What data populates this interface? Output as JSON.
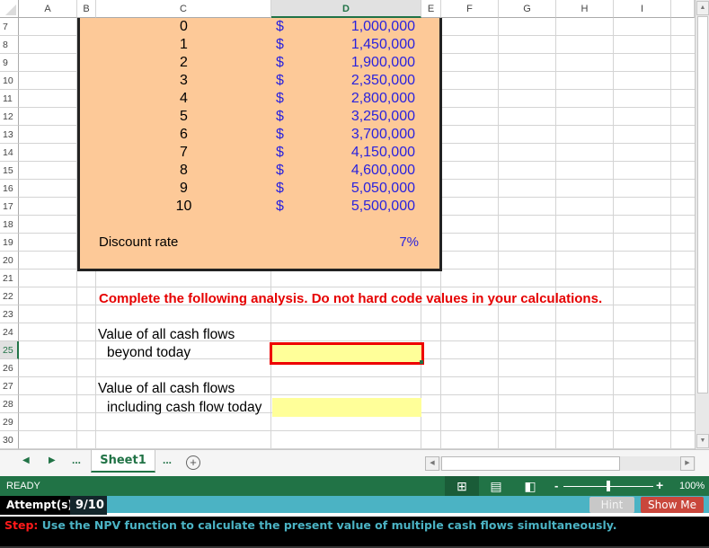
{
  "columns": [
    "A",
    "B",
    "C",
    "D",
    "E",
    "F",
    "G",
    "H",
    "I"
  ],
  "selected_column": "D",
  "rows": [
    7,
    8,
    9,
    10,
    11,
    12,
    13,
    14,
    15,
    16,
    17,
    18,
    19,
    20,
    21,
    22,
    23,
    24,
    25,
    26,
    27,
    28,
    29,
    30
  ],
  "selected_row": 25,
  "cash_flows": [
    {
      "period": "0",
      "currency": "$",
      "amount": "1,000,000"
    },
    {
      "period": "1",
      "currency": "$",
      "amount": "1,450,000"
    },
    {
      "period": "2",
      "currency": "$",
      "amount": "1,900,000"
    },
    {
      "period": "3",
      "currency": "$",
      "amount": "2,350,000"
    },
    {
      "period": "4",
      "currency": "$",
      "amount": "2,800,000"
    },
    {
      "period": "5",
      "currency": "$",
      "amount": "3,250,000"
    },
    {
      "period": "6",
      "currency": "$",
      "amount": "3,700,000"
    },
    {
      "period": "7",
      "currency": "$",
      "amount": "4,150,000"
    },
    {
      "period": "8",
      "currency": "$",
      "amount": "4,600,000"
    },
    {
      "period": "9",
      "currency": "$",
      "amount": "5,050,000"
    },
    {
      "period": "10",
      "currency": "$",
      "amount": "5,500,000"
    }
  ],
  "discount_rate": {
    "label": "Discount rate",
    "value": "7%"
  },
  "instruction": "Complete the following analysis. Do not hard code values in your calculations.",
  "analysis": {
    "q1_line1": "Value of all cash flows",
    "q1_line2": "beyond today",
    "q1_value": "",
    "q2_line1": "Value of all cash flows",
    "q2_line2": "including cash flow today",
    "q2_value": ""
  },
  "tabs": {
    "prev": "◀",
    "next": "▶",
    "more_left": "...",
    "sheet": "Sheet1",
    "more_right": "...",
    "add": "+"
  },
  "status": {
    "mode": "READY",
    "zoom_minus": "-",
    "zoom_plus": "+",
    "zoom": "100%",
    "zoom_level_percent": 100
  },
  "attempts": {
    "label": "Attempt(s)",
    "value": "9/10"
  },
  "buttons": {
    "hint": "Hint",
    "show_me": "Show Me"
  },
  "step": {
    "label": "Step:",
    "text": " Use the NPV function to calculate the present value of multiple cash flows simultaneously."
  },
  "colors": {
    "accent": "#217346",
    "input_fill": "#ffff99",
    "block_fill": "#fdc998",
    "value_blue": "#2a22dd",
    "instruction_red": "#e60000",
    "active_border": "#ee0000"
  }
}
